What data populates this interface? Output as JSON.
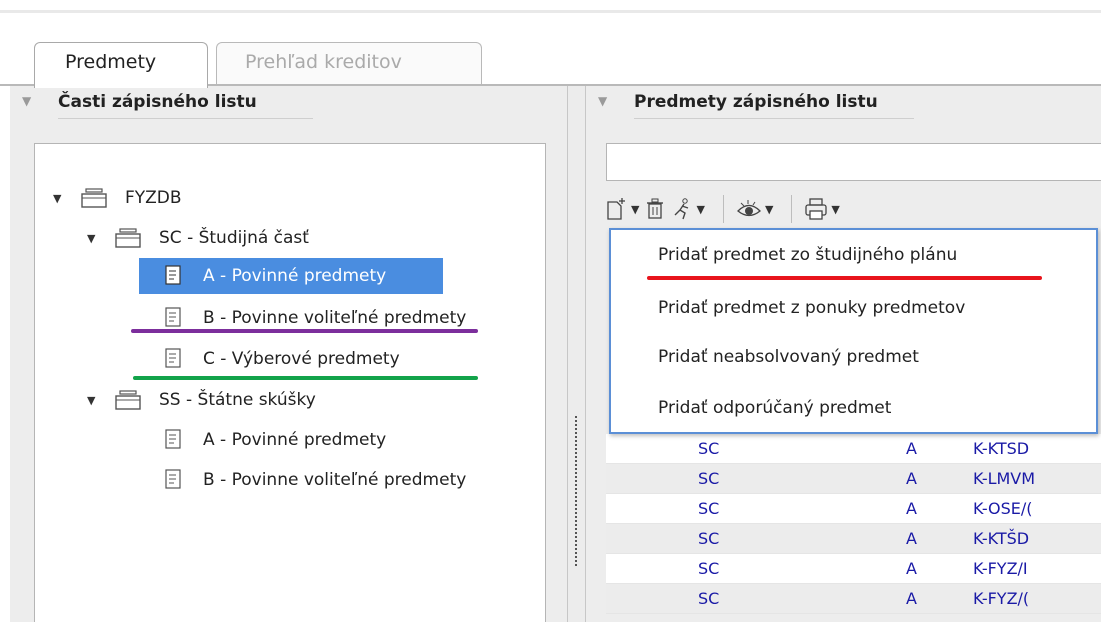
{
  "tabs": [
    {
      "label": "Predmety",
      "active": true
    },
    {
      "label": "Prehľad kreditov",
      "active": false
    }
  ],
  "left_panel": {
    "title": "Časti zápisného listu",
    "tree": [
      {
        "label": "FYZDB",
        "type": "folder",
        "expanded": true
      },
      {
        "label": "SC - Študijná časť",
        "type": "folder",
        "expanded": true
      },
      {
        "label": "A - Povinné predmety",
        "type": "doc",
        "selected": true
      },
      {
        "label": "B - Povinne voliteľné predmety",
        "type": "doc"
      },
      {
        "label": "C - Výberové predmety",
        "type": "doc"
      },
      {
        "label": "SS - Štátne skúšky",
        "type": "folder",
        "expanded": true
      },
      {
        "label": "A - Povinné predmety",
        "type": "doc"
      },
      {
        "label": "B - Povinne voliteľné predmety",
        "type": "doc"
      }
    ]
  },
  "right_panel": {
    "title": "Predmety zápisného listu",
    "toolbar_icons": [
      "add-document-icon",
      "trash-icon",
      "running-figure-icon",
      "eye-icon",
      "printer-icon"
    ],
    "rows": [
      [
        "SC",
        "A",
        "K-KTSD"
      ],
      [
        "SC",
        "A",
        "K-LMVM"
      ],
      [
        "SC",
        "A",
        "K-OSE/("
      ],
      [
        "SC",
        "A",
        "K-KTŠD"
      ],
      [
        "SC",
        "A",
        "K-FYZ/I"
      ],
      [
        "SC",
        "A",
        "K-FYZ/("
      ]
    ]
  },
  "dropdown_menu": {
    "items": [
      "Pridať predmet zo študijného plánu",
      "Pridať predmet z ponuky predmetov",
      "Pridať neabsolvovaný predmet",
      "Pridať odporúčaný predmet"
    ]
  },
  "colors": {
    "selection": "#4a8de0",
    "menu_border": "#5b8fd6",
    "underline_red": "#e8141c",
    "underline_purple": "#7c2e9c",
    "underline_green": "#12a34a",
    "table_text": "#1a1aa6"
  }
}
